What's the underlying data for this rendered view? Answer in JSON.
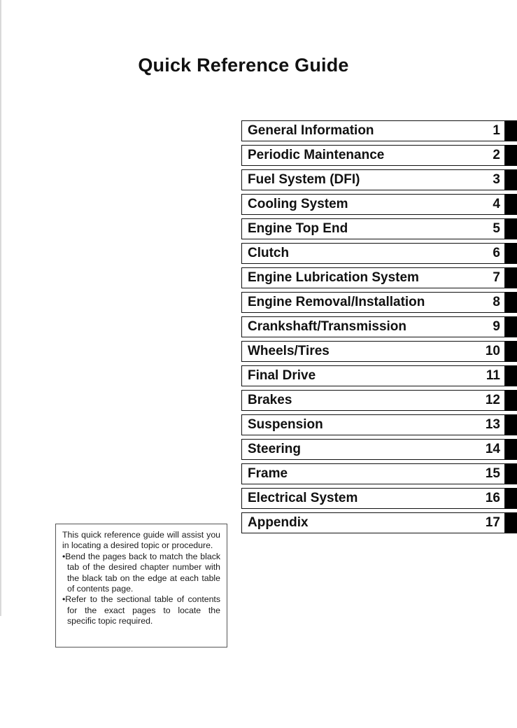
{
  "document": {
    "title": "Quick Reference Guide"
  },
  "chapter_index": {
    "rows": [
      {
        "label": "General Information",
        "number": "1"
      },
      {
        "label": "Periodic Maintenance",
        "number": "2"
      },
      {
        "label": "Fuel System (DFI)",
        "number": "3"
      },
      {
        "label": "Cooling System",
        "number": "4"
      },
      {
        "label": "Engine Top End",
        "number": "5"
      },
      {
        "label": "Clutch",
        "number": "6"
      },
      {
        "label": "Engine Lubrication System",
        "number": "7"
      },
      {
        "label": "Engine Removal/Installation",
        "number": "8"
      },
      {
        "label": "Crankshaft/Transmission",
        "number": "9"
      },
      {
        "label": "Wheels/Tires",
        "number": "10"
      },
      {
        "label": "Final Drive",
        "number": "11"
      },
      {
        "label": "Brakes",
        "number": "12"
      },
      {
        "label": "Suspension",
        "number": "13"
      },
      {
        "label": "Steering",
        "number": "14"
      },
      {
        "label": "Frame",
        "number": "15"
      },
      {
        "label": "Electrical System",
        "number": "16"
      },
      {
        "label": "Appendix",
        "number": "17"
      }
    ]
  },
  "note": {
    "intro": "This quick reference guide will assist you in locating a desired topic or procedure.",
    "bullets": [
      "•Bend the pages back to match the black tab of the desired chapter number with the black tab on the edge at each table of contents page.",
      "•Refer to the sectional table of contents for the exact pages to locate the specific topic required."
    ]
  },
  "colors": {
    "tab_black": "#000000",
    "text_black": "#111111",
    "page_background": "#ffffff"
  }
}
